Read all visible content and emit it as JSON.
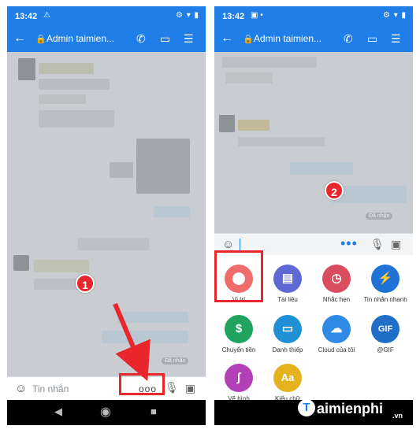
{
  "colors": {
    "accent": "#1f7ee8",
    "highlight": "#e8262c"
  },
  "left": {
    "status": {
      "time": "13:42"
    },
    "header": {
      "title": "Admin taimien..."
    },
    "seen": "Đã nhận",
    "input": {
      "placeholder": "Tin nhắn"
    },
    "more_label": "ooo",
    "step": "1"
  },
  "right": {
    "status": {
      "time": "13:42"
    },
    "header": {
      "title": "Admin taimien..."
    },
    "seen": "Đã nhận",
    "step": "2",
    "features": [
      {
        "label": "Vị trí",
        "icon": "location-pin-icon",
        "color": "#f06b6b"
      },
      {
        "label": "Tài liệu",
        "icon": "document-icon",
        "color": "#5e69d6"
      },
      {
        "label": "Nhắc hẹn",
        "icon": "alarm-clock-icon",
        "color": "#d94d5e"
      },
      {
        "label": "Tin nhắn nhanh",
        "icon": "quick-message-icon",
        "color": "#1f73d6"
      },
      {
        "label": "Chuyển tiền",
        "icon": "money-transfer-icon",
        "color": "#1fa35f"
      },
      {
        "label": "Danh thiếp",
        "icon": "contact-card-icon",
        "color": "#1f8fd6"
      },
      {
        "label": "Cloud của tôi",
        "icon": "cloud-icon",
        "color": "#2f8ae6"
      },
      {
        "label": "@GIF",
        "icon": "gif-icon",
        "color": "#1f6fc8"
      },
      {
        "label": "Vẽ hình",
        "icon": "draw-icon",
        "color": "#b03fb8"
      },
      {
        "label": "Kiểu chữ",
        "icon": "font-style-icon",
        "color": "#e3b21d"
      }
    ]
  },
  "watermark": {
    "badge": "T",
    "brand": "aimienphi",
    "tld": ".vn"
  }
}
